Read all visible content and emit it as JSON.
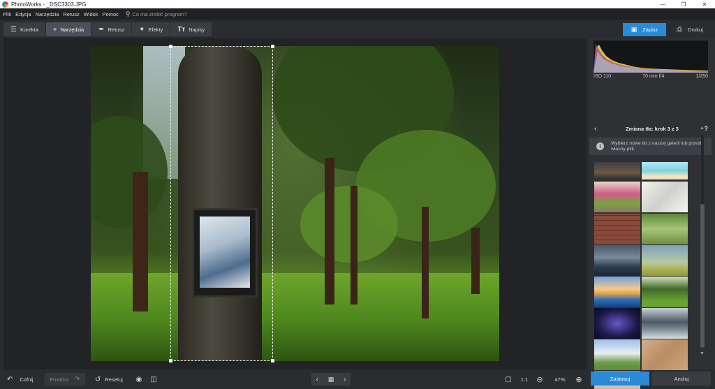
{
  "window": {
    "title": "PhotoWorks - _DSC3303.JPG",
    "controls": [
      "minimize-icon",
      "maximize-icon",
      "close-icon"
    ]
  },
  "menu": {
    "items": [
      "Plik",
      "Edycja",
      "Narzędzia",
      "Retusz",
      "Widok",
      "Pomoc"
    ],
    "search_placeholder": "Co ma zrobić program?"
  },
  "tabs": [
    {
      "label": "Korekta",
      "icon": "sliders-icon",
      "active": false
    },
    {
      "label": "Narzędzia",
      "icon": "crop-icon",
      "active": true
    },
    {
      "label": "Retusz",
      "icon": "brush-icon",
      "active": false
    },
    {
      "label": "Efekty",
      "icon": "magic-wand-icon",
      "active": false
    },
    {
      "label": "Napisy",
      "icon": "text-icon",
      "active": false
    }
  ],
  "toolbar": {
    "save_label": "Zapisz",
    "print_label": "Drukuj"
  },
  "bottom": {
    "undo_label": "Cofnij",
    "redo_label": "Powtórz",
    "reset_label": "Resetuj",
    "zoom_fit_label": "1:1",
    "zoom_value": "47%"
  },
  "panel": {
    "exif": {
      "iso": "ISO 110",
      "lens": "70 mm f/4",
      "shutter": "1/250"
    },
    "header": "Zmiana tła: krok 3 z 3",
    "info": "Wybierz nowe tło z naszej galerii lub prześlij własny plik.",
    "apply_label": "Zastosuj",
    "cancel_label": "Anuluj"
  },
  "colors": {
    "accent": "#2b8ad6",
    "background": "#2b2c30",
    "panel": "#2f3034"
  }
}
